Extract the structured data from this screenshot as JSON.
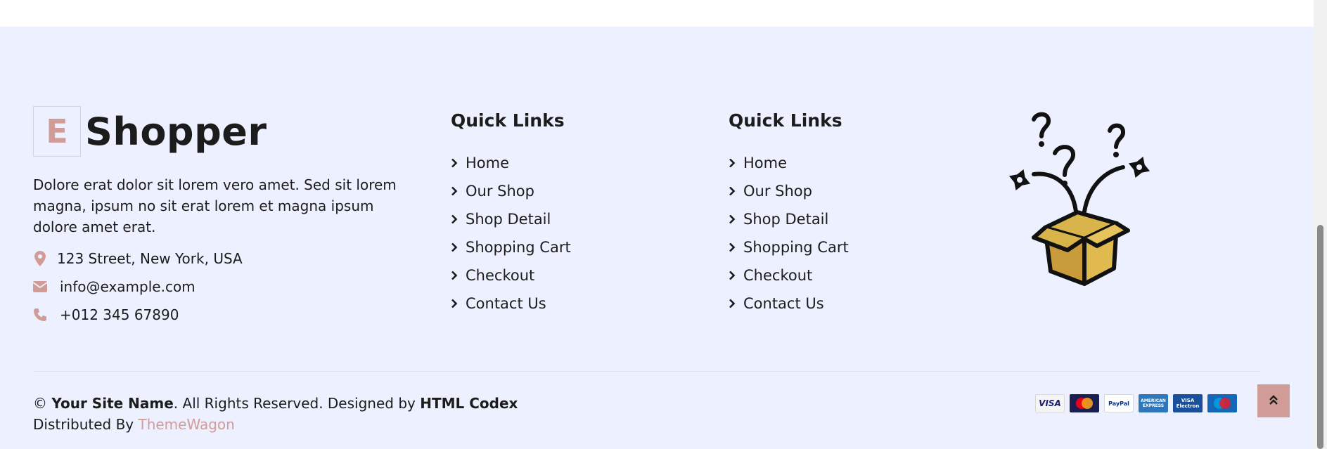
{
  "brand": {
    "logo_letter": "E",
    "name": "Shopper"
  },
  "about": {
    "description": "Dolore erat dolor sit lorem vero amet. Sed sit lorem magna, ipsum no sit erat lorem et magna ipsum dolore amet erat."
  },
  "contact": {
    "address": "123 Street, New York, USA",
    "email": "info@example.com",
    "phone": "+012 345 67890"
  },
  "quick_links_1": {
    "title": "Quick Links",
    "items": [
      "Home",
      "Our Shop",
      "Shop Detail",
      "Shopping Cart",
      "Checkout",
      "Contact Us"
    ]
  },
  "quick_links_2": {
    "title": "Quick Links",
    "items": [
      "Home",
      "Our Shop",
      "Shop Detail",
      "Shopping Cart",
      "Checkout",
      "Contact Us"
    ]
  },
  "copyright": {
    "symbol": "©",
    "site_name": "Your Site Name",
    "rights": ". All Rights Reserved. Designed by",
    "designer": "HTML Codex",
    "distributed_by": "Distributed By",
    "distributor": "ThemeWagon"
  },
  "payments": [
    {
      "name": "VISA",
      "icon": "visa-card-icon"
    },
    {
      "name": "MasterCard",
      "icon": "mastercard-card-icon"
    },
    {
      "name": "PayPal",
      "icon": "paypal-card-icon"
    },
    {
      "name": "AMERICAN EXPRESS",
      "icon": "amex-card-icon"
    },
    {
      "name": "VISA Electron",
      "icon": "visa-electron-card-icon"
    },
    {
      "name": "Maestro",
      "icon": "maestro-card-icon"
    }
  ],
  "icons": {
    "address": "map-marker-icon",
    "email": "envelope-icon",
    "phone": "phone-icon",
    "link": "chevron-right-icon",
    "back_to_top": "double-chevron-up-icon"
  },
  "colors": {
    "accent": "#d19c97",
    "footer_bg": "#edf1ff",
    "text": "#1c1c1c"
  }
}
